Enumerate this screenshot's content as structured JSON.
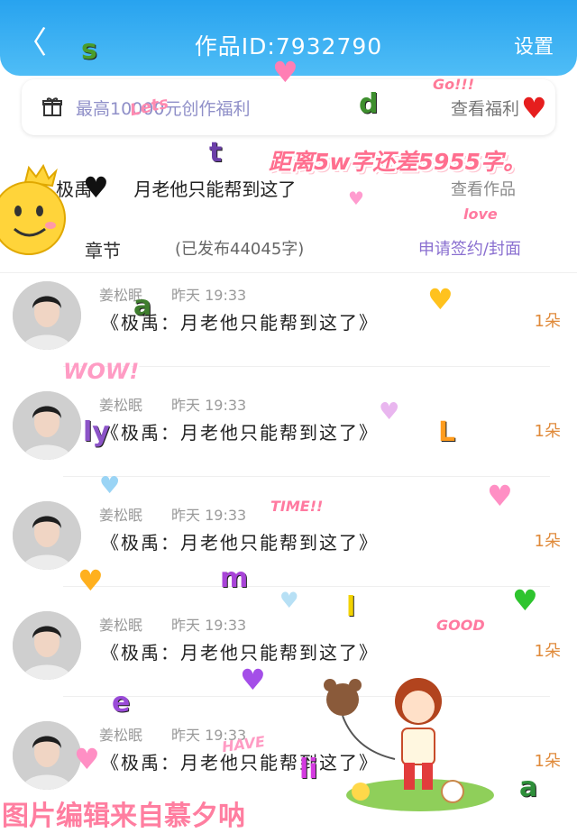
{
  "header": {
    "back_label": "〈",
    "title": "作品ID:7932790",
    "settings_label": "设置"
  },
  "welfare": {
    "text": "最高10000元创作福利",
    "link": "查看福利"
  },
  "work": {
    "title": "极禹",
    "work_link": "查看作品",
    "work_subtitle": "月老他只能帮到这了",
    "chapter_label": "章节",
    "chapter_count": "(已发布44045字)",
    "chapter_link": "申请签约/封面"
  },
  "banner": "距离5w字还差5955字。",
  "comments": [
    {
      "name": "姜松眠",
      "time": "昨天 19:33",
      "text": "《极禹：月老他只能帮到这了》",
      "gift": "1朵"
    },
    {
      "name": "姜松眠",
      "time": "昨天 19:33",
      "text": "《极禹：月老他只能帮到这了》",
      "gift": "1朵"
    },
    {
      "name": "姜松眠",
      "time": "昨天 19:33",
      "text": "《极禹：月老他只能帮到这了》",
      "gift": "1朵"
    },
    {
      "name": "姜松眠",
      "time": "昨天 19:33",
      "text": "《极禹：月老他只能帮到这了》",
      "gift": "1朵"
    },
    {
      "name": "姜松眠",
      "time": "昨天 19:33",
      "text": "《极禹：月老他只能帮到这了》",
      "gift": "1朵"
    }
  ],
  "stickers": {
    "letters": [
      "s",
      "d",
      "t",
      "a",
      "ly",
      "L",
      "m",
      "l",
      "e",
      "li",
      "a"
    ],
    "words": [
      "Lets",
      "Go!!!",
      "love",
      "WOW!",
      "TIME!!",
      "GOOD",
      "HAVE"
    ]
  },
  "watermark": "图片编辑来自慕夕呐",
  "colors": {
    "header_blue": "#28a3ef",
    "banner_pink": "#ff6f8f",
    "gift_orange": "#e08a3a",
    "welfare_purple": "#8f8fc8"
  }
}
